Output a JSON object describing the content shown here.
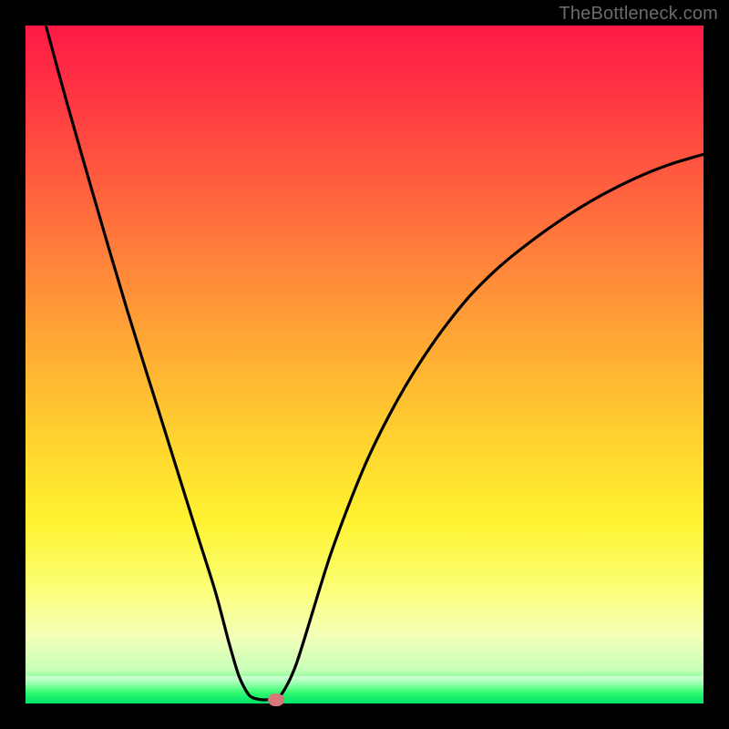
{
  "watermark": "TheBottleneck.com",
  "chart_data": {
    "type": "line",
    "title": "",
    "xlabel": "",
    "ylabel": "",
    "xlim": [
      0,
      100
    ],
    "ylim": [
      0,
      100
    ],
    "grid": false,
    "legend": false,
    "series": [
      {
        "name": "bottleneck-curve",
        "color": "#000000",
        "points": [
          {
            "x": 3.0,
            "y": 100.0
          },
          {
            "x": 6.0,
            "y": 89.0
          },
          {
            "x": 10.0,
            "y": 75.0
          },
          {
            "x": 15.0,
            "y": 58.0
          },
          {
            "x": 20.0,
            "y": 42.0
          },
          {
            "x": 25.0,
            "y": 26.0
          },
          {
            "x": 28.0,
            "y": 16.5
          },
          {
            "x": 30.0,
            "y": 9.0
          },
          {
            "x": 31.5,
            "y": 4.0
          },
          {
            "x": 33.0,
            "y": 1.2
          },
          {
            "x": 34.5,
            "y": 0.6
          },
          {
            "x": 36.0,
            "y": 0.6
          },
          {
            "x": 37.5,
            "y": 1.0
          },
          {
            "x": 40.0,
            "y": 6.0
          },
          {
            "x": 45.0,
            "y": 22.0
          },
          {
            "x": 50.0,
            "y": 35.0
          },
          {
            "x": 55.0,
            "y": 45.0
          },
          {
            "x": 60.0,
            "y": 53.0
          },
          {
            "x": 65.0,
            "y": 59.5
          },
          {
            "x": 70.0,
            "y": 64.5
          },
          {
            "x": 75.0,
            "y": 68.5
          },
          {
            "x": 80.0,
            "y": 72.0
          },
          {
            "x": 85.0,
            "y": 75.0
          },
          {
            "x": 90.0,
            "y": 77.5
          },
          {
            "x": 95.0,
            "y": 79.5
          },
          {
            "x": 100.0,
            "y": 81.0
          }
        ]
      }
    ],
    "marker": {
      "x": 37.0,
      "y": 0.6,
      "color": "#d6787a"
    }
  }
}
